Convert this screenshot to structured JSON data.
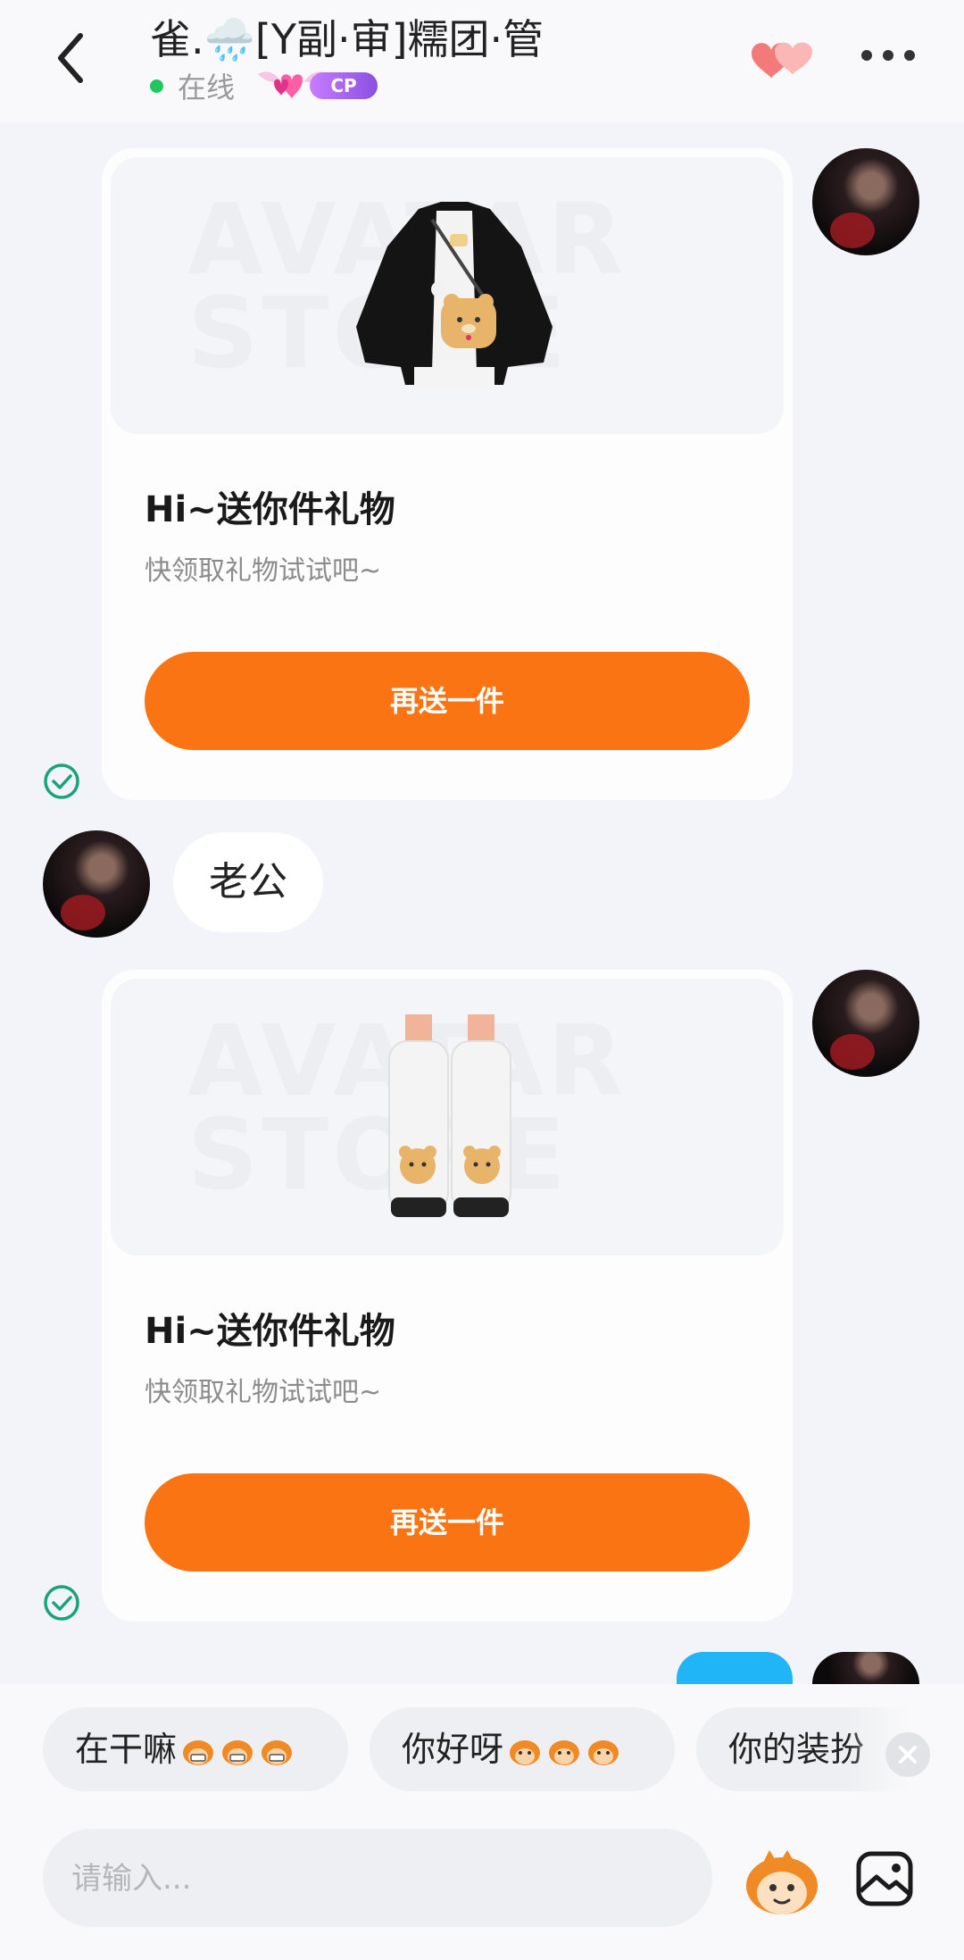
{
  "header": {
    "title": "雀.🌧️[Y副·审]糯团·管",
    "status": "在线",
    "badge": "CP"
  },
  "messages": [
    {
      "type": "gift-card",
      "side": "right",
      "item": "black-white-jacket-with-bear-bag",
      "watermark": "AVATAR STORE",
      "title": "Hi~送你件礼物",
      "subtitle": "快领取礼物试试吧~",
      "button": "再送一件",
      "sent": true
    },
    {
      "type": "text",
      "side": "left",
      "text": "老公"
    },
    {
      "type": "gift-card",
      "side": "right",
      "item": "white-fluffy-bear-boots",
      "watermark": "AVATAR STORE",
      "title": "Hi~送你件礼物",
      "subtitle": "快领取礼物试试吧~",
      "button": "再送一件",
      "sent": true
    }
  ],
  "quick_replies": [
    {
      "label": "在干嘛",
      "emoji": "grinning-monkey-emoji"
    },
    {
      "label": "你好呀",
      "emoji": "monkey-face-emoji"
    },
    {
      "label": "你的装扮"
    }
  ],
  "composer": {
    "placeholder": "请输入..."
  },
  "colors": {
    "accent_orange": "#fb7414",
    "online_green": "#22c55e",
    "check_teal": "#1aa37a",
    "page_bg": "#f2f4f9"
  }
}
